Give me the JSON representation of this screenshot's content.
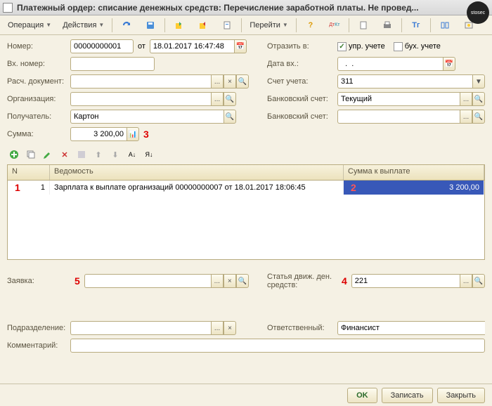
{
  "window": {
    "title": "Платежный ордер: списание денежных средств: Перечисление заработной платы. Не провед..."
  },
  "toolbar": {
    "operation": "Операция",
    "actions": "Действия",
    "goto": "Перейти"
  },
  "fields": {
    "number_label": "Номер:",
    "number_value": "00000000001",
    "from": "от",
    "date_value": "18.01.2017 16:47:48",
    "in_number_label": "Вх. номер:",
    "in_date_label": "Дата вх.:",
    "in_date_value": "  .  .    ",
    "doc_label": "Расч. документ:",
    "account_label": "Счет учета:",
    "account_value": "311",
    "org_label": "Организация:",
    "bank_label": "Банковский счет:",
    "bank_value": "Текущий",
    "recipient_label": "Получатель:",
    "recipient_value": "Картон",
    "bank2_label": "Банковский счет:",
    "sum_label": "Сумма:",
    "sum_value": "3 200,00",
    "reflect_label": "Отразить в:",
    "chk1": "упр. учете",
    "chk2": "бух. учете",
    "request_label": "Заявка:",
    "dds_label": "Статья движ. ден. средств:",
    "dds_value": "221",
    "dept_label": "Подразделение:",
    "resp_label": "Ответственный:",
    "resp_value": "Финансист",
    "comment_label": "Комментарий:"
  },
  "grid": {
    "col_n": "N",
    "col_ved": "Ведомость",
    "col_sum": "Сумма к выплате",
    "rows": [
      {
        "n": "1",
        "ved": "Зарплата к выплате организаций 00000000007 от 18.01.2017 18:06:45",
        "sum": "3 200,00"
      }
    ]
  },
  "marks": {
    "m1": "1",
    "m2": "2",
    "m3": "3",
    "m4": "4",
    "m5": "5"
  },
  "footer": {
    "ok": "OK",
    "save": "Записать",
    "close": "Закрыть"
  }
}
